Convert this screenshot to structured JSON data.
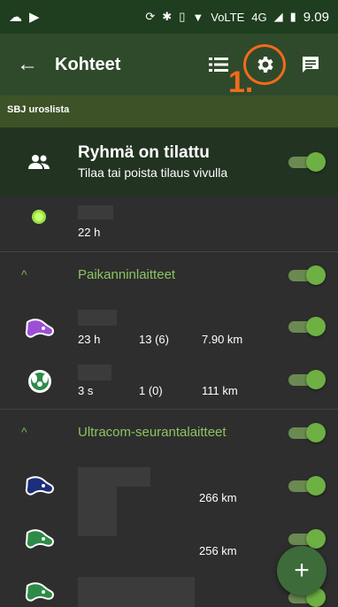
{
  "statusbar": {
    "network": "4G",
    "volte": "VoLTE",
    "time": "9.09"
  },
  "appbar": {
    "title": "Kohteet"
  },
  "annotation": {
    "label": "1."
  },
  "group": {
    "name": "SBJ uroslista"
  },
  "subscription": {
    "heading": "Ryhmä on tilattu",
    "description": "Tilaa tai poista tilaus vivulla",
    "enabled": true
  },
  "own_device": {
    "time": "22 h"
  },
  "sections": [
    {
      "title": "Paikanninlaitteet",
      "enabled": true,
      "devices": [
        {
          "time": "23 h",
          "count": "13 (6)",
          "distance": "7.90 km",
          "enabled": true
        },
        {
          "time": "3 s",
          "count": "1 (0)",
          "distance": "111 km",
          "enabled": true
        }
      ]
    },
    {
      "title": "Ultracom-seurantalaitteet",
      "enabled": true,
      "devices": [
        {
          "distance": "266 km",
          "enabled": true
        },
        {
          "distance": "256 km",
          "enabled": true
        },
        {
          "distance": "",
          "enabled": true
        }
      ]
    }
  ],
  "fab": {
    "label": "+"
  },
  "colors": {
    "accent": "#6eb043",
    "annotation": "#f26a1b",
    "purple_device": "#9b4fd6",
    "navy_device": "#1c2f7a",
    "green_device": "#2e8b47"
  }
}
